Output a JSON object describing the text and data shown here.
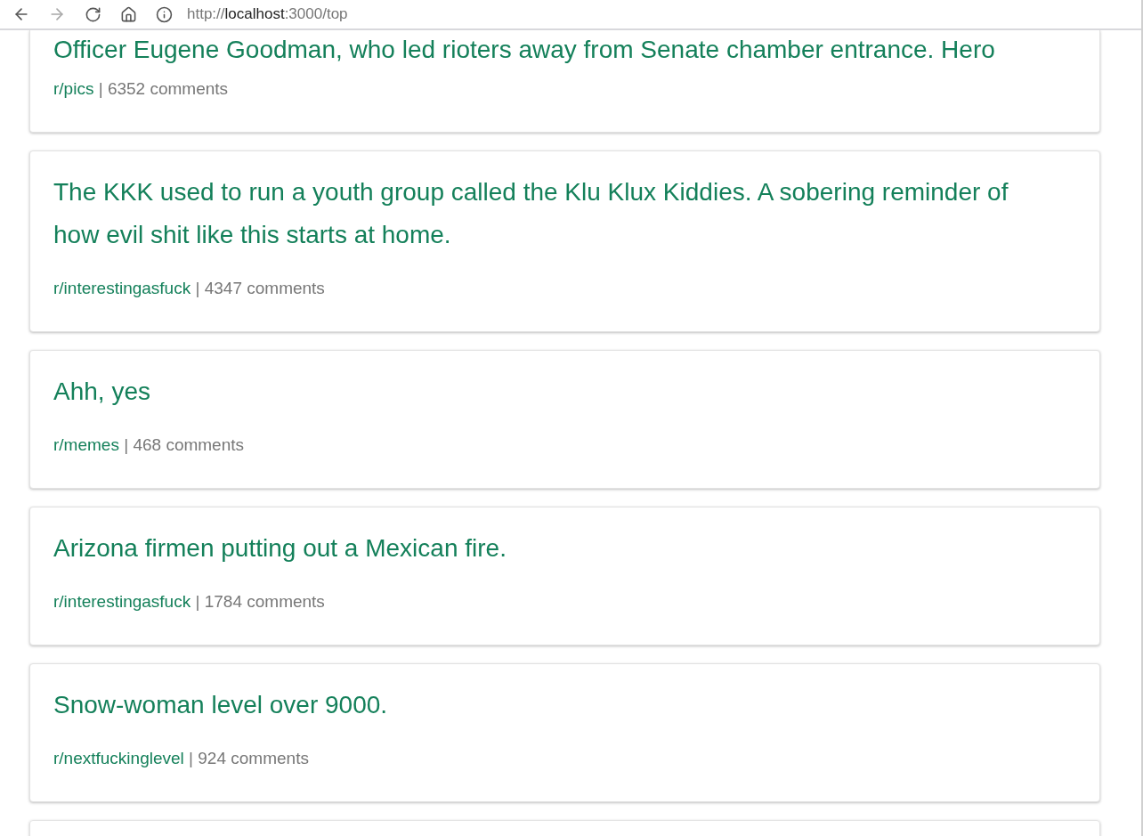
{
  "browser": {
    "back_disabled": false,
    "forward_disabled": true,
    "url": {
      "scheme": "http://",
      "host": "localhost",
      "rest": ":3000/top"
    }
  },
  "posts": [
    {
      "title": "Officer Eugene Goodman, who led rioters away from Senate chamber entrance. Hero",
      "subreddit": "r/pics",
      "separator": "|",
      "comments": "6352 comments"
    },
    {
      "title": "The KKK used to run a youth group called the Klu Klux Kiddies. A sobering reminder of how evil shit like this starts at home.",
      "subreddit": "r/interestingasfuck",
      "separator": "|",
      "comments": "4347 comments"
    },
    {
      "title": "Ahh, yes",
      "subreddit": "r/memes",
      "separator": "|",
      "comments": "468 comments"
    },
    {
      "title": "Arizona firmen putting out a Mexican fire.",
      "subreddit": "r/interestingasfuck",
      "separator": "|",
      "comments": "1784 comments"
    },
    {
      "title": "Snow-woman level over 9000.",
      "subreddit": "r/nextfuckinglevel",
      "separator": "|",
      "comments": "924 comments"
    }
  ]
}
